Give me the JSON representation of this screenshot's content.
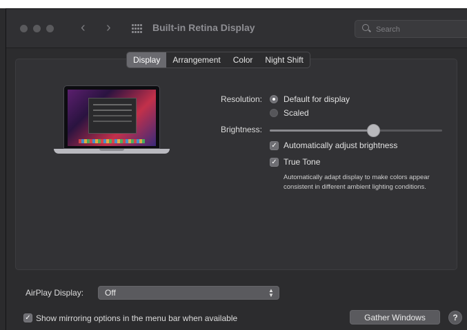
{
  "window": {
    "title": "Built-in Retina Display",
    "search_placeholder": "Search",
    "nav_back": "‹",
    "nav_forward": "›"
  },
  "tabs": [
    {
      "label": "Display",
      "active": true
    },
    {
      "label": "Arrangement",
      "active": false
    },
    {
      "label": "Color",
      "active": false
    },
    {
      "label": "Night Shift",
      "active": false
    }
  ],
  "display": {
    "resolution_label": "Resolution:",
    "resolution_options": [
      {
        "label": "Default for display",
        "selected": true
      },
      {
        "label": "Scaled",
        "selected": false
      }
    ],
    "brightness_label": "Brightness:",
    "brightness_value": 0.6,
    "auto_brightness_label": "Automatically adjust brightness",
    "auto_brightness_checked": true,
    "true_tone_label": "True Tone",
    "true_tone_checked": true,
    "true_tone_description": "Automatically adapt display to make colors appear consistent in different ambient lighting conditions."
  },
  "footer": {
    "airplay_label": "AirPlay Display:",
    "airplay_value": "Off",
    "mirroring_label": "Show mirroring options in the menu bar when available",
    "mirroring_checked": true,
    "gather_windows_label": "Gather Windows",
    "help_label": "?"
  }
}
